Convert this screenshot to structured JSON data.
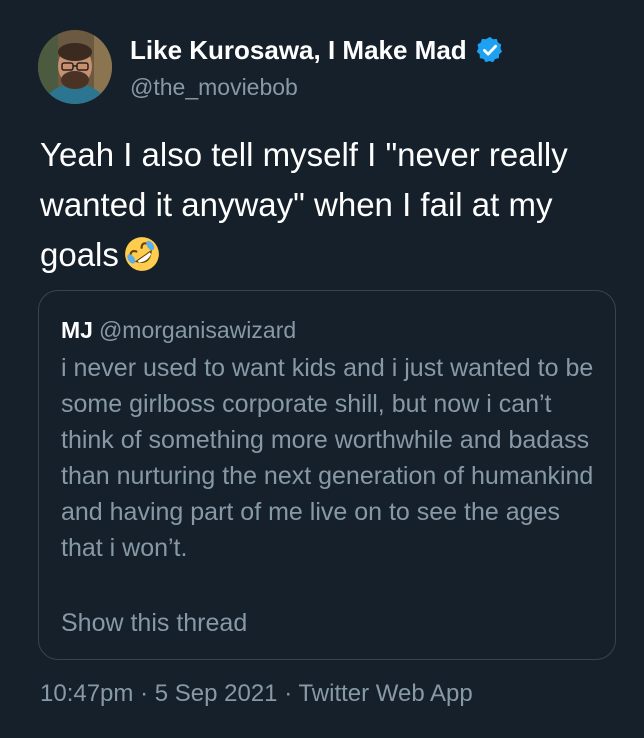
{
  "author": {
    "display_name": "Like Kurosawa, I Make Mad",
    "handle": "@the_moviebob",
    "verified_icon": "verified-badge-icon"
  },
  "tweet": {
    "text": "Yeah I also tell myself I \"never really wanted it anyway\" when I fail at my goals",
    "emoji": "rolling-on-floor-laughing-emoji"
  },
  "quoted_tweet": {
    "name": "MJ",
    "handle": "@morganisawizard",
    "text": "i never used to want kids and i just wanted to be some girlboss corporate shill, but now i can’t think of something more worthwhile and badass than nurturing the next generation of humankind and having part of me live on to see the ages that i won’t.",
    "show_thread": "Show this thread"
  },
  "meta": {
    "time": "10:47pm",
    "separator": "·",
    "date": "5 Sep 2021",
    "source": "Twitter Web App"
  },
  "colors": {
    "background": "#15202b",
    "text_primary": "#ffffff",
    "text_secondary": "#8899a6",
    "border": "#38444d",
    "verified": "#1da1f2"
  }
}
